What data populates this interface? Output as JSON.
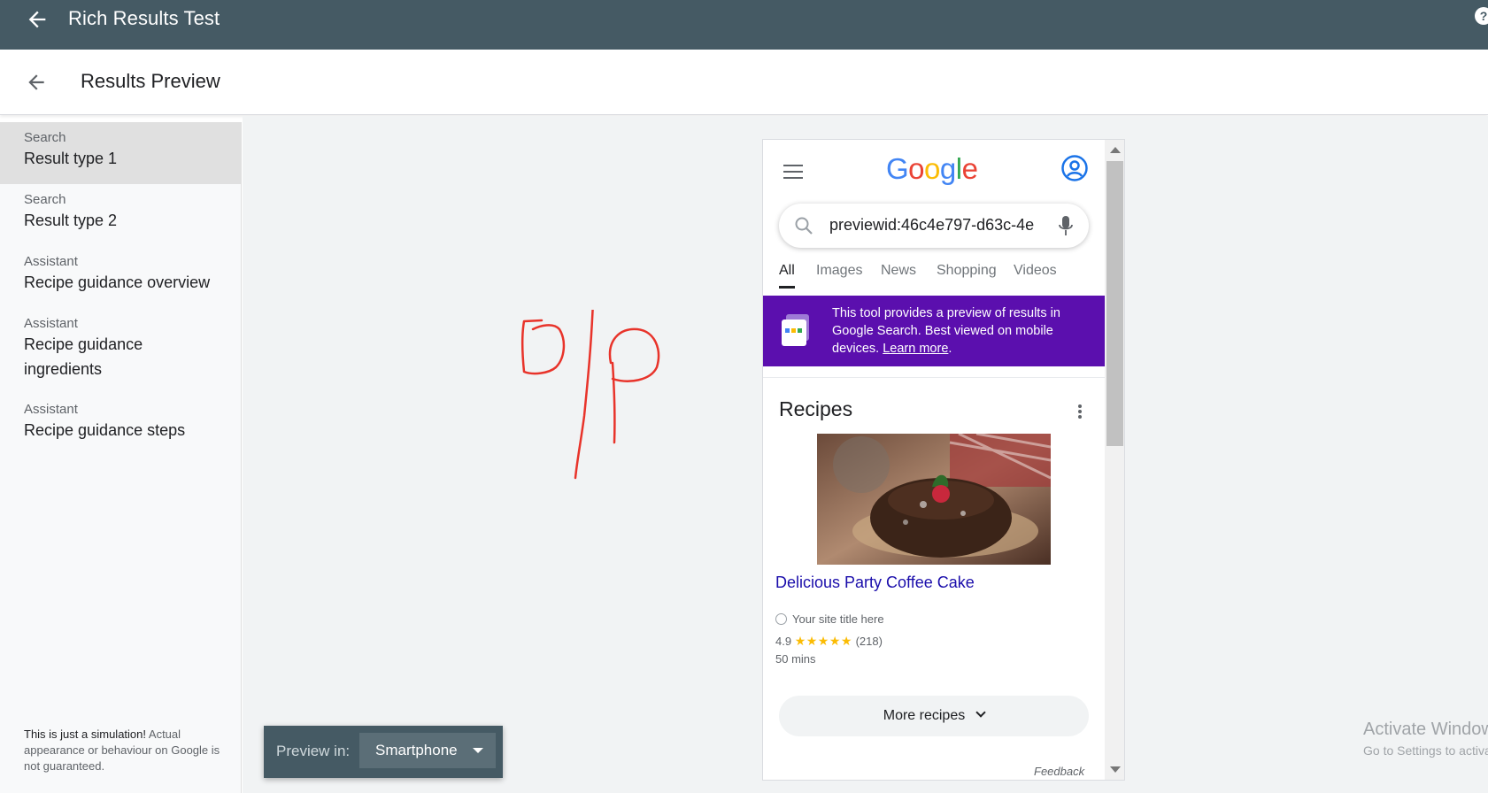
{
  "app": {
    "title": "Rich Results Test",
    "help_icon": "help-icon"
  },
  "subheader": {
    "title": "Results Preview"
  },
  "sidebar": {
    "items": [
      {
        "category": "Search",
        "label": "Result type 1",
        "active": true
      },
      {
        "category": "Search",
        "label": "Result type 2",
        "active": false
      },
      {
        "category": "Assistant",
        "label": "Recipe guidance overview",
        "active": false
      },
      {
        "category": "Assistant",
        "label": "Recipe guidance ingredients",
        "active": false
      },
      {
        "category": "Assistant",
        "label": "Recipe guidance steps",
        "active": false
      }
    ],
    "footer_bold": "This is just a simulation!",
    "footer_text": " Actual appearance or behaviour on Google is not guaranteed."
  },
  "phone": {
    "logo": "Google",
    "search_value": "previewid:46c4e797-d63c-4e",
    "tabs": [
      "All",
      "Images",
      "News",
      "Shopping",
      "Videos"
    ],
    "active_tab": "All",
    "banner_text": "This tool provides a preview of results in Google Search. Best viewed on mobile devices. ",
    "banner_link": "Learn more",
    "banner_end": ".",
    "card_title": "Recipes",
    "recipe_title": "Delicious Party Coffee Cake",
    "site_title": "Your site title here",
    "rating_value": "4.9",
    "rating_stars": 5,
    "rating_count": "(218)",
    "time": "50 mins",
    "more_button": "More recipes",
    "feedback": "Feedback"
  },
  "preview_bar": {
    "label": "Preview in:",
    "selected": "Smartphone"
  },
  "watermark": {
    "line1": "Activate Windows",
    "line2": "Go to Settings to activate Windows."
  },
  "colors": {
    "header_bg": "#455a64",
    "banner_bg": "#5b0fae",
    "link": "#1a0dab",
    "star": "#fbbc04",
    "doodle": "#e8332a"
  }
}
